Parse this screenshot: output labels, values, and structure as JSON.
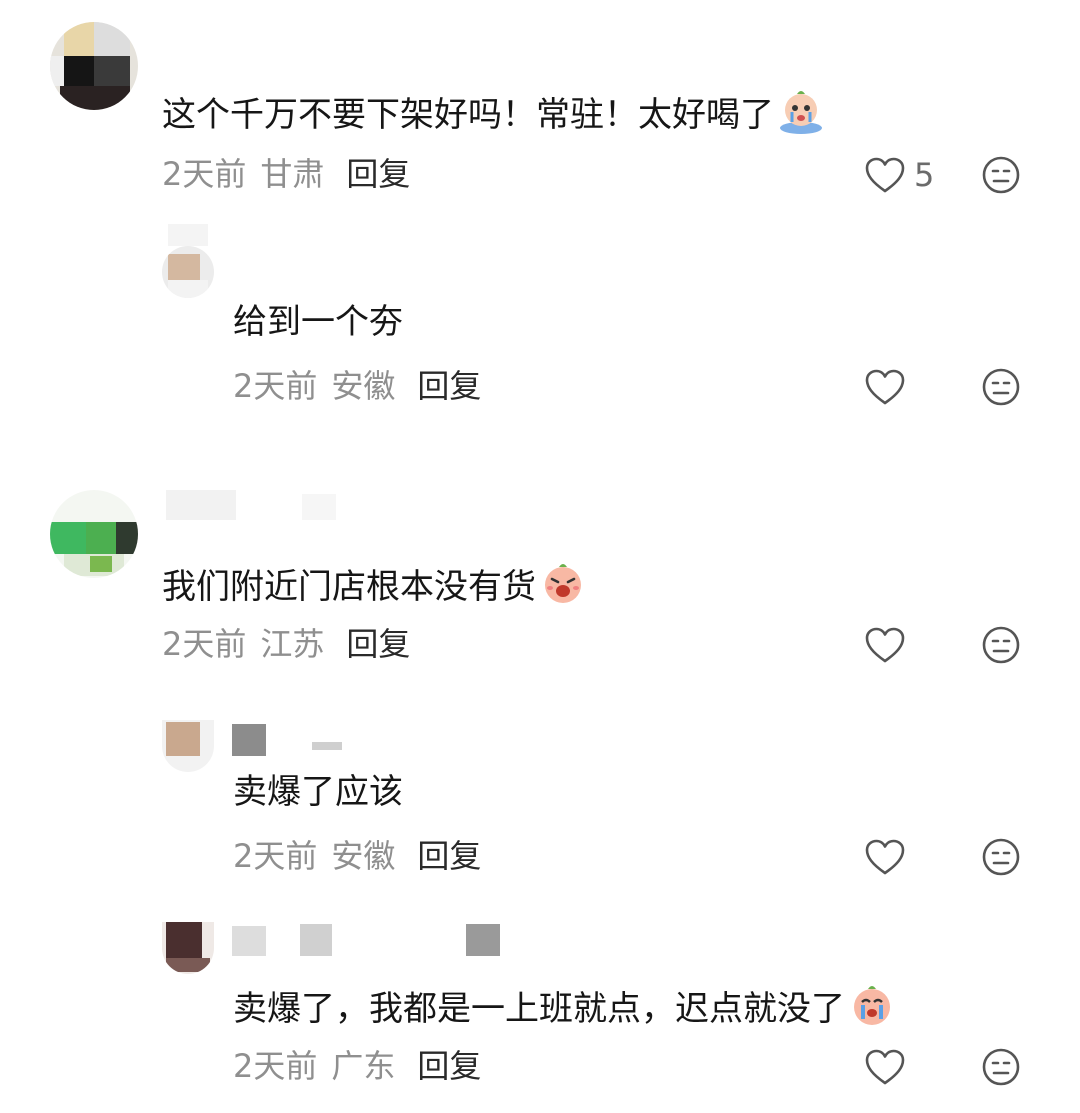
{
  "comments": [
    {
      "text": "这个千万不要下架好吗！常驻！太好喝了",
      "emoji": "crying-face-emoji",
      "time": "2天前",
      "location": "甘肃",
      "reply": "回复",
      "likes": "5"
    },
    {
      "text": "给到一个夯",
      "time": "2天前",
      "location": "安徽",
      "reply": "回复"
    },
    {
      "text": "我们附近门店根本没有货",
      "emoji": "shouting-face-emoji",
      "time": "2天前",
      "location": "江苏",
      "reply": "回复"
    },
    {
      "text": "卖爆了应该",
      "time": "2天前",
      "location": "安徽",
      "reply": "回复"
    },
    {
      "text": "卖爆了，我都是一上班就点，迟点就没了",
      "emoji": "crying-face-emoji",
      "time": "2天前",
      "location": "广东",
      "reply": "回复"
    }
  ],
  "colors": {
    "text": "#161616",
    "meta": "#8f8f8f",
    "icon": "#555555"
  }
}
